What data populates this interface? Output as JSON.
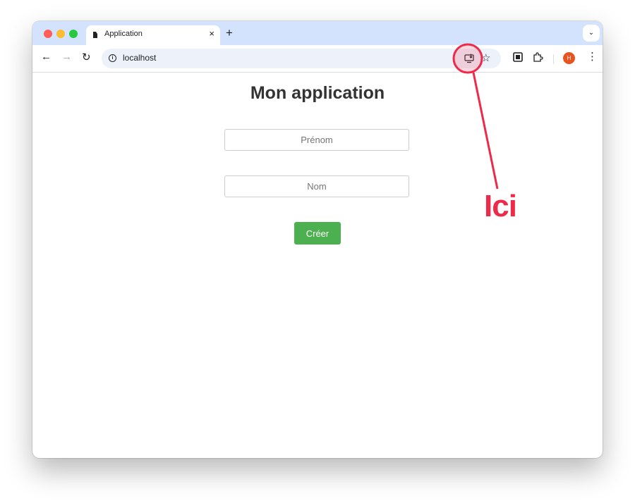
{
  "browser": {
    "tab_title": "Application",
    "tab_close": "×",
    "new_tab": "+",
    "tab_search": "⌄",
    "url": "localhost",
    "avatar_initial": "H",
    "nav": {
      "back": "←",
      "forward": "→",
      "reload": "↻"
    },
    "star": "☆",
    "menu": "⋮",
    "info": "i"
  },
  "page": {
    "title": "Mon application",
    "first_name_placeholder": "Prénom",
    "last_name_placeholder": "Nom",
    "create_label": "Créer",
    "button_color": "#4caf50"
  },
  "annotation": {
    "label": "Ici",
    "color": "#ee2a4a"
  }
}
